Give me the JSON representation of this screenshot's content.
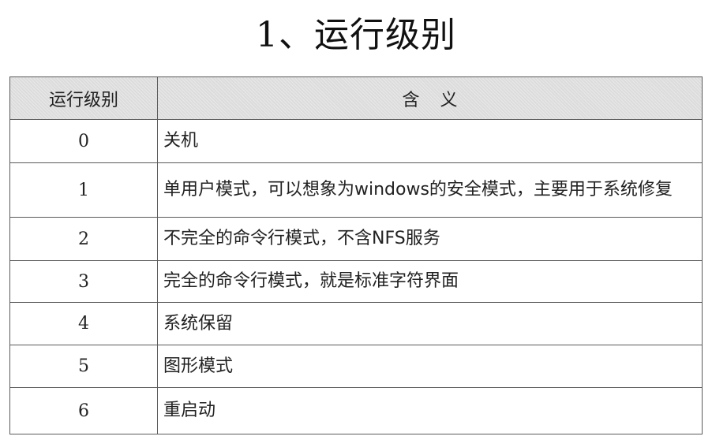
{
  "title": "1、运行级别",
  "table": {
    "headers": {
      "level": "运行级别",
      "meaning": "含义"
    },
    "rows": [
      {
        "level": "0",
        "meaning": "关机"
      },
      {
        "level": "1",
        "meaning": "单用户模式，可以想象为windows的安全模式，主要用于系统修复"
      },
      {
        "level": "2",
        "meaning": "不完全的命令行模式，不含NFS服务"
      },
      {
        "level": "3",
        "meaning": "完全的命令行模式，就是标准字符界面"
      },
      {
        "level": "4",
        "meaning": "系统保留"
      },
      {
        "level": "5",
        "meaning": "图形模式"
      },
      {
        "level": "6",
        "meaning": "重启动"
      }
    ]
  },
  "colors": {
    "header_background": "#dcdcdc",
    "border": "#5a5a5a",
    "text": "#222222"
  }
}
